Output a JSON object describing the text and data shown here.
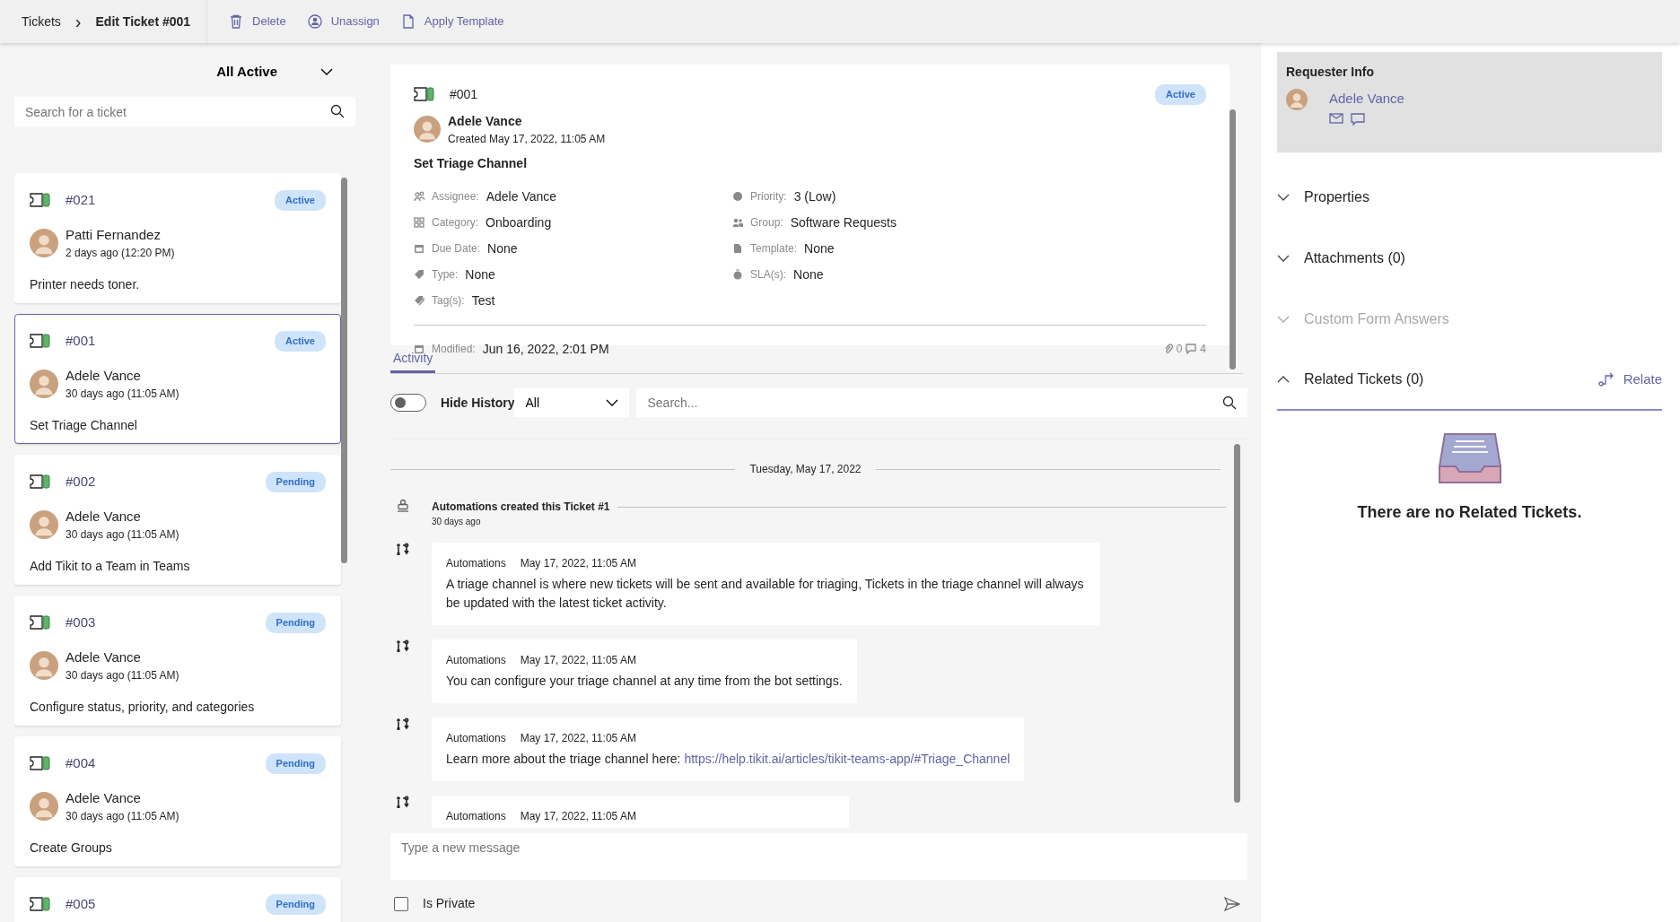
{
  "breadcrumb": {
    "parent": "Tickets",
    "separator": "›",
    "current": "Edit Ticket #001"
  },
  "toolbar": [
    "Delete",
    "Unassign",
    "Apply Template"
  ],
  "ticket_list": {
    "filter": "All Active",
    "search": {
      "placeholder": "Search for a ticket"
    },
    "tickets": [
      {
        "number": "#021",
        "status": "Active",
        "name": "Patti Fernandez",
        "time": "2 days ago (12:20 PM)",
        "title": "Printer needs toner.",
        "selected": false
      },
      {
        "number": "#001",
        "status": "Active",
        "name": "Adele Vance",
        "time": "30 days ago (11:05 AM)",
        "title": "Set Triage Channel",
        "selected": true
      },
      {
        "number": "#002",
        "status": "Pending",
        "name": "Adele Vance",
        "time": "30 days ago (11:05 AM)",
        "title": "Add Tikit to a Team in Teams",
        "selected": false
      },
      {
        "number": "#003",
        "status": "Pending",
        "name": "Adele Vance",
        "time": "30 days ago (11:05 AM)",
        "title": "Configure status, priority, and categories",
        "selected": false
      },
      {
        "number": "#004",
        "status": "Pending",
        "name": "Adele Vance",
        "time": "30 days ago (11:05 AM)",
        "title": "Create Groups",
        "selected": false
      },
      {
        "number": "#005",
        "status": "Pending",
        "selected": false
      }
    ]
  },
  "ticket": {
    "number": "#001",
    "status": "Active",
    "requester": "Adele Vance",
    "created": "Created May 17, 2022, 11:05 AM",
    "title": "Set Triage Channel",
    "fields_left": [
      {
        "label": "Assignee:",
        "value": "Adele Vance"
      },
      {
        "label": "Category:",
        "value": "Onboarding"
      },
      {
        "label": "Due Date:",
        "value": "None"
      },
      {
        "label": "Type:",
        "value": "None"
      },
      {
        "label": "Tag(s):",
        "value": "Test"
      }
    ],
    "fields_right": [
      {
        "label": "Priority:",
        "value": "3 (Low)"
      },
      {
        "label": "Group:",
        "value": "Software Requests"
      },
      {
        "label": "Template:",
        "value": "None"
      },
      {
        "label": "SLA(s):",
        "value": "None"
      }
    ],
    "modified_label": "Modified:",
    "modified": "Jun 16, 2022, 2:01 PM",
    "attachment_count": "0",
    "comment_count": "4"
  },
  "activity": {
    "tabs": [
      {
        "label": "Activity",
        "selected": true
      }
    ],
    "hide_history": {
      "label": "Hide History",
      "on": false
    },
    "type_filter": "All",
    "search": {
      "placeholder": "Search..."
    },
    "date": "Tuesday, May 17, 2022",
    "feed": [
      {
        "kind": "event",
        "text": "Automations created this Ticket #1",
        "time": "30 days ago"
      },
      {
        "kind": "message",
        "author": "Automations",
        "time": "May 17, 2022, 11:05 AM",
        "text": "A triage channel is where new tickets will be sent and available for triaging, Tickets in the triage channel will always be updated with the latest ticket activity."
      },
      {
        "kind": "message",
        "author": "Automations",
        "time": "May 17, 2022, 11:05 AM",
        "text": "You can configure your triage channel at any time from the bot settings."
      },
      {
        "kind": "message",
        "author": "Automations",
        "time": "May 17, 2022, 11:05 AM",
        "text": "Learn more about the triage channel here: ",
        "link": "https://help.tikit.ai/articles/tikit-teams-app/#Triage_Channel"
      },
      {
        "kind": "message",
        "author": "Automations",
        "time": "May 17, 2022, 11:05 AM"
      }
    ],
    "composer": {
      "placeholder": "Type a new message"
    },
    "private": {
      "label": "Is Private",
      "checked": false
    }
  },
  "side_panel": {
    "requester_title": "Requester Info",
    "requester": "Adele Vance",
    "sections": [
      {
        "label": "Properties",
        "expanded": false,
        "disabled": false
      },
      {
        "label": "Attachments (0)",
        "expanded": false,
        "disabled": false
      },
      {
        "label": "Custom Form Answers",
        "expanded": false,
        "disabled": true
      },
      {
        "label": "Related Tickets (0)",
        "expanded": true,
        "disabled": false,
        "action": "Relate",
        "empty": "There are no Related Tickets."
      }
    ]
  }
}
